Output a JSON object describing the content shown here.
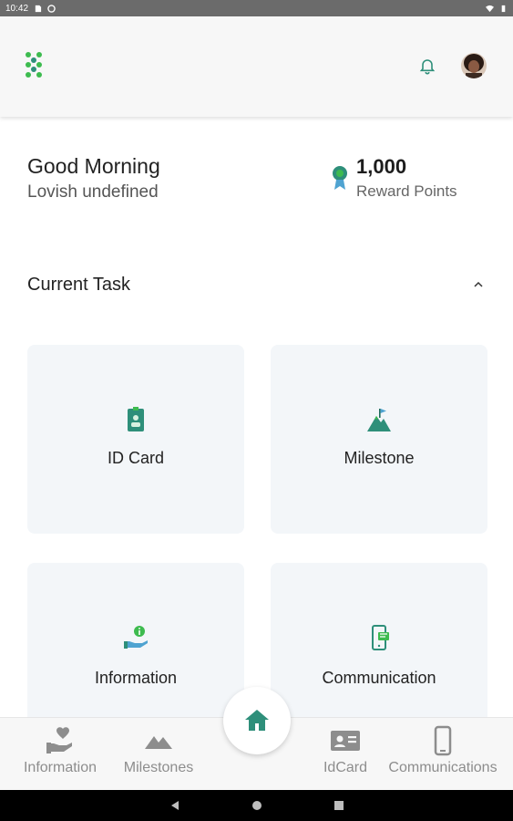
{
  "status_bar": {
    "time": "10:42"
  },
  "greeting": {
    "title": "Good Morning",
    "name": "Lovish undefined"
  },
  "reward": {
    "points": "1,000",
    "label": "Reward Points"
  },
  "current_task": {
    "title": "Current Task"
  },
  "cards": [
    {
      "label": "ID Card",
      "icon": "id-card-icon"
    },
    {
      "label": "Milestone",
      "icon": "milestone-icon"
    },
    {
      "label": "Information",
      "icon": "information-icon"
    },
    {
      "label": "Communication",
      "icon": "communication-icon"
    }
  ],
  "bottom_nav": [
    {
      "label": "Information",
      "icon": "hand-heart-icon"
    },
    {
      "label": "Milestones",
      "icon": "mountain-icon"
    },
    {
      "label": "IdCard",
      "icon": "id-card-icon"
    },
    {
      "label": "Communications",
      "icon": "phone-icon"
    }
  ],
  "colors": {
    "accent": "#2e8f7a",
    "accent_green": "#3dbb4f",
    "card_bg": "#f3f6f9",
    "nav_label": "#8d8d8d"
  }
}
